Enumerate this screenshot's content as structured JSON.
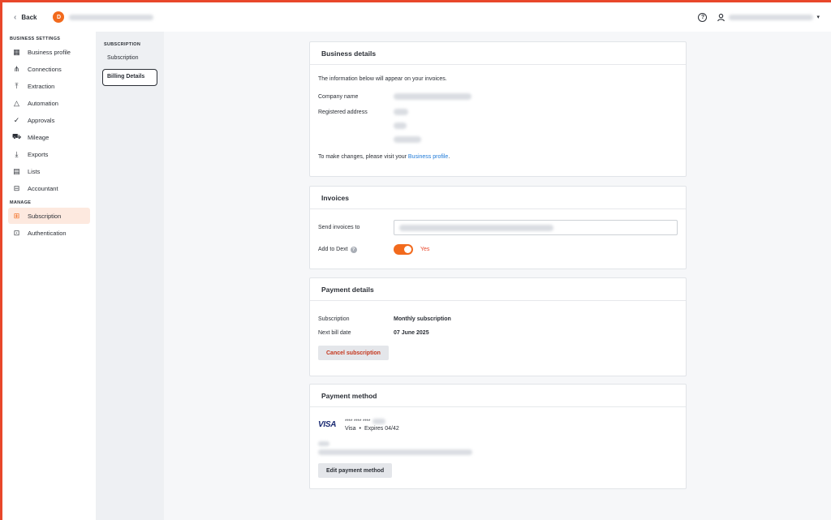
{
  "topbar": {
    "back_label": "Back",
    "avatar_initial": "D",
    "help_icon": "?",
    "caret": "▾"
  },
  "sidebar": {
    "business_settings_title": "BUSINESS SETTINGS",
    "business_items": [
      {
        "label": "Business profile",
        "icon": "building-icon"
      },
      {
        "label": "Connections",
        "icon": "connections-icon"
      },
      {
        "label": "Extraction",
        "icon": "upload-icon"
      },
      {
        "label": "Automation",
        "icon": "shapes-icon"
      },
      {
        "label": "Approvals",
        "icon": "check-icon"
      },
      {
        "label": "Mileage",
        "icon": "car-icon"
      },
      {
        "label": "Exports",
        "icon": "download-icon"
      },
      {
        "label": "Lists",
        "icon": "clipboard-icon"
      },
      {
        "label": "Accountant",
        "icon": "briefcase-icon"
      }
    ],
    "manage_title": "MANAGE",
    "manage_items": [
      {
        "label": "Subscription",
        "icon": "grid-plus-icon",
        "active": true
      },
      {
        "label": "Authentication",
        "icon": "lock-icon"
      }
    ]
  },
  "subnav": {
    "title": "SUBSCRIPTION",
    "items": [
      {
        "label": "Subscription"
      },
      {
        "label": "Billing Details",
        "active": true
      }
    ]
  },
  "business_details": {
    "title": "Business details",
    "intro": "The information below will appear on your invoices.",
    "company_name_label": "Company name",
    "registered_address_label": "Registered address",
    "changes_text": "To make changes, please visit your ",
    "changes_link": "Business profile",
    "changes_end": "."
  },
  "invoices": {
    "title": "Invoices",
    "send_label": "Send invoices to",
    "add_label": "Add to Dext",
    "info_icon": "?",
    "toggle_value": "Yes"
  },
  "payment_details": {
    "title": "Payment details",
    "subscription_label": "Subscription",
    "subscription_value": "Monthly subscription",
    "next_bill_label": "Next bill date",
    "next_bill_value": "07 June 2025",
    "cancel_button": "Cancel subscription"
  },
  "payment_method": {
    "title": "Payment method",
    "card_brand_logo": "VISA",
    "card_number": "**** **** ****",
    "card_type": "Visa",
    "separator": "•",
    "expires": "Expires 04/42",
    "edit_button": "Edit payment method"
  },
  "colors": {
    "accent": "#f26a1d",
    "frame": "#e8472b",
    "link": "#1f7ad8"
  }
}
